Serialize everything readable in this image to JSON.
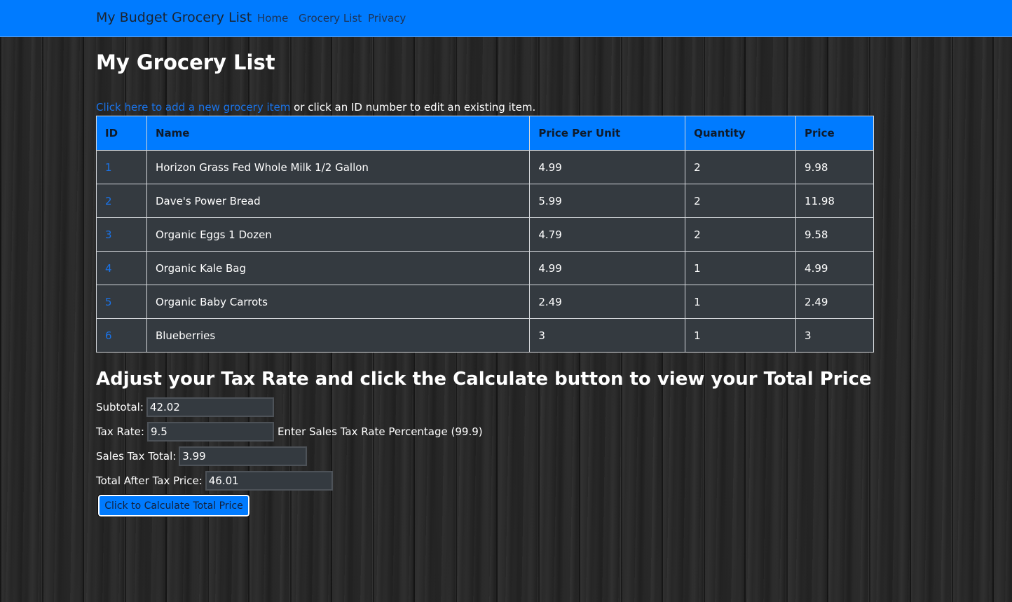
{
  "navbar": {
    "brand": "My Budget Grocery List",
    "links": [
      "Home",
      "Grocery List",
      "Privacy"
    ],
    "color": "#007bff"
  },
  "page": {
    "title": "My Grocery List",
    "intro_link": "Click here to add a new grocery item",
    "intro_text": " or click an ID number to edit an existing item."
  },
  "table": {
    "headers": [
      "ID",
      "Name",
      "Price Per Unit",
      "Quantity",
      "Price"
    ],
    "rows": [
      [
        "1",
        "Horizon Grass Fed Whole Milk 1/2 Gallon",
        "4.99",
        "2",
        "9.98"
      ],
      [
        "2",
        "Dave's Power Bread",
        "5.99",
        "2",
        "11.98"
      ],
      [
        "3",
        "Organic Eggs 1 Dozen",
        "4.79",
        "2",
        "9.58"
      ],
      [
        "4",
        "Organic Kale Bag",
        "4.99",
        "1",
        "4.99"
      ],
      [
        "5",
        "Organic Baby Carrots",
        "2.49",
        "1",
        "2.49"
      ],
      [
        "6",
        "Blueberries",
        "3",
        "1",
        "3"
      ]
    ]
  },
  "tax": {
    "heading": "Adjust your Tax Rate and click the Calculate button to view your Total Price",
    "subtotal_label": "Subtotal:",
    "subtotal_value": "42.02",
    "rate_label": "Tax Rate:",
    "rate_value": "9.5",
    "rate_hint": "Enter Sales Tax Rate Percentage (99.9)",
    "sales_tax_label": "Sales Tax Total:",
    "sales_tax_value": "3.99",
    "total_label": "Total After Tax Price:",
    "total_value": "46.01",
    "button_label": "Click to Calculate Total Price"
  }
}
